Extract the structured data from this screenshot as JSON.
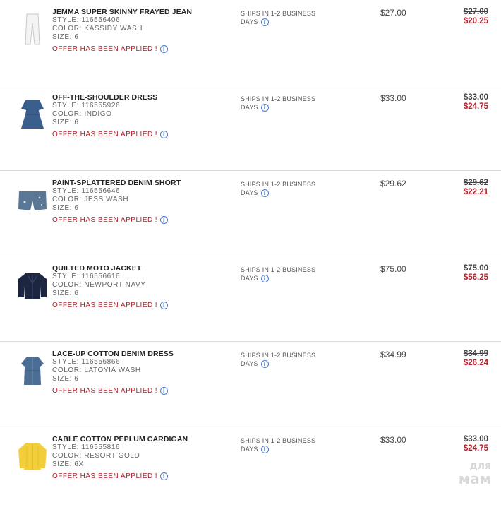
{
  "items": [
    {
      "name": "JEMMA SUPER SKINNY FRAYED JEAN",
      "style": "STYLE:  116556406",
      "color": "COLOR:  KASSIDY WASH",
      "size": "SIZE:  6",
      "offer": "OFFER HAS BEEN APPLIED",
      "offer_sep": "!",
      "ship_line1": "SHIPS IN 1-2 BUSINESS",
      "ship_line2": "DAYS",
      "price": "$27.00",
      "was": "$27.00",
      "now": "$20.25",
      "thumb": "white-jeans-icon",
      "thumb_color": "#f1f1f1"
    },
    {
      "name": "OFF-THE-SHOULDER DRESS",
      "style": "STYLE:  116555926",
      "color": "COLOR:  INDIGO",
      "size": "SIZE:  6",
      "offer": "OFFER HAS BEEN APPLIED",
      "offer_sep": "!",
      "ship_line1": "SHIPS IN 1-2 BUSINESS",
      "ship_line2": "DAYS",
      "price": "$33.00",
      "was": "$33.00",
      "now": "$24.75",
      "thumb": "dress-icon",
      "thumb_color": "#3a5f8c"
    },
    {
      "name": "PAINT-SPLATTERED DENIM SHORT",
      "style": "STYLE:  116556646",
      "color": "COLOR:  JESS WASH",
      "size": "SIZE:  6",
      "offer": "OFFER HAS BEEN APPLIED",
      "offer_sep": "!",
      "ship_line1": "SHIPS IN 1-2 BUSINESS",
      "ship_line2": "DAYS",
      "price": "$29.62",
      "was": "$29.62",
      "now": "$22.21",
      "thumb": "shorts-icon",
      "thumb_color": "#5b7796"
    },
    {
      "name": "QUILTED MOTO JACKET",
      "style": "STYLE:  116556616",
      "color": "COLOR:  NEWPORT NAVY",
      "size": "SIZE:  6",
      "offer": "OFFER HAS BEEN APPLIED",
      "offer_sep": "!",
      "ship_line1": "SHIPS IN 1-2 BUSINESS",
      "ship_line2": "DAYS",
      "price": "$75.00",
      "was": "$75.00",
      "now": "$56.25",
      "thumb": "jacket-icon",
      "thumb_color": "#1d2640"
    },
    {
      "name": "LACE-UP COTTON DENIM DRESS",
      "style": "STYLE:  116556866",
      "color": "COLOR:  LATOYIA WASH",
      "size": "SIZE:  6",
      "offer": "OFFER HAS BEEN APPLIED",
      "offer_sep": "!",
      "ship_line1": "SHIPS IN 1-2 BUSINESS",
      "ship_line2": "DAYS",
      "price": "$34.99",
      "was": "$34.99",
      "now": "$26.24",
      "thumb": "denim-dress-icon",
      "thumb_color": "#4d6e94"
    },
    {
      "name": "CABLE COTTON PEPLUM CARDIGAN",
      "style": "STYLE:  116555816",
      "color": "COLOR:  RESORT GOLD",
      "size": "SIZE:  6X",
      "offer": "OFFER HAS BEEN APPLIED",
      "offer_sep": "!",
      "ship_line1": "SHIPS IN 1-2 BUSINESS",
      "ship_line2": "DAYS",
      "price": "$33.00",
      "was": "$33.00",
      "now": "$24.75",
      "thumb": "cardigan-icon",
      "thumb_color": "#f2cf3a"
    }
  ],
  "watermark": {
    "line1": "для",
    "line2": "мам"
  },
  "colors": {
    "offer_red": "#b0212a",
    "info_blue": "#4a79c9",
    "divider": "#dcdcdc"
  }
}
